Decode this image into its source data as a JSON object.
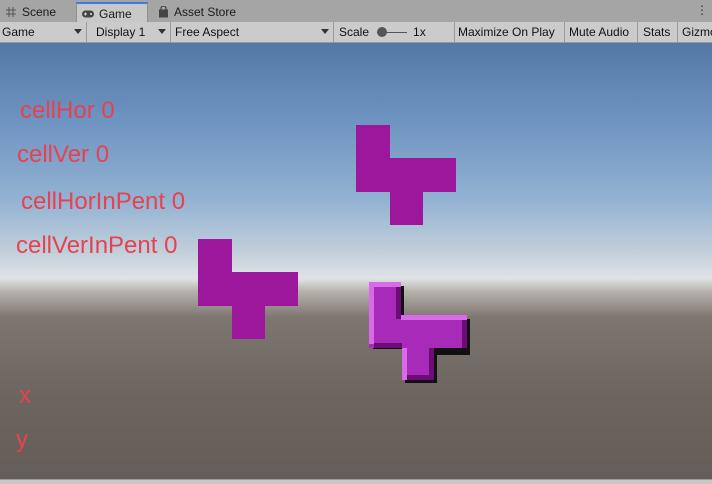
{
  "tabs": [
    {
      "label": "Scene",
      "icon": "grid-icon"
    },
    {
      "label": "Game",
      "icon": "gamepad-icon"
    },
    {
      "label": "Asset Store",
      "icon": "store-bag-icon"
    }
  ],
  "toolbar": {
    "view_select": "Game",
    "display_select": "Display 1",
    "aspect_select": "Free Aspect",
    "scale_label": "Scale",
    "scale_value": "1x",
    "maximize_on_play": "Maximize On Play",
    "mute_audio": "Mute Audio",
    "stats": "Stats",
    "gizmos": "Gizmos"
  },
  "overlay_text": {
    "cell_hor": "cellHor 0",
    "cell_ver": "cellVer 0",
    "cell_hor_in_pent": "cellHorInPent 0",
    "cell_ver_in_pent": "cellVerInPent 0",
    "x": "x",
    "y": "y"
  },
  "colors": {
    "overlay_text": "#e8414f",
    "piece_flat": "#9c179c",
    "piece_highlight": "#c42cd6",
    "tab_accent": "#3a7de0"
  }
}
